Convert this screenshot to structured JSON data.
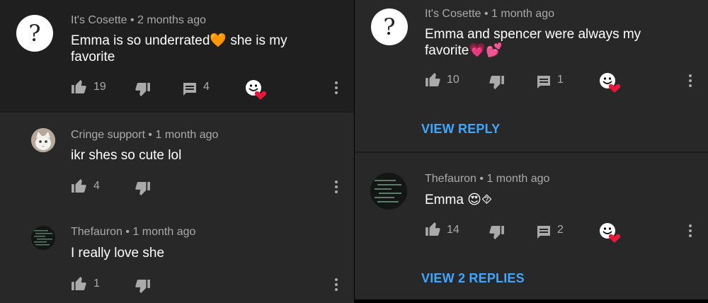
{
  "left": {
    "comments": [
      {
        "author": "It's Cosette",
        "time": "2 months ago",
        "text": "Emma is so underrated🧡 she is my favorite",
        "likes": "19",
        "replies": "4"
      },
      {
        "author": "Cringe support",
        "time": "1 month ago",
        "text": "ikr shes so cute lol",
        "likes": "4"
      },
      {
        "author": "Thefauron",
        "time": "1 month ago",
        "text": "I really love she",
        "likes": "1"
      }
    ]
  },
  "right": {
    "comments": [
      {
        "author": "It's Cosette",
        "time": "1 month ago",
        "text": "Emma and spencer were always my favorite💗💕",
        "likes": "10",
        "replies": "1",
        "view_replies": "VIEW REPLY"
      },
      {
        "author": "Thefauron",
        "time": "1 month ago",
        "text": "Emma 😍⯑",
        "likes": "14",
        "replies": "2",
        "view_replies": "VIEW 2 REPLIES"
      }
    ]
  },
  "separator": "•",
  "colors": {
    "background": "#282828",
    "link": "#3ea6ff",
    "meta": "#aaaaaa",
    "text": "#ffffff",
    "heart": "#e8173a"
  }
}
